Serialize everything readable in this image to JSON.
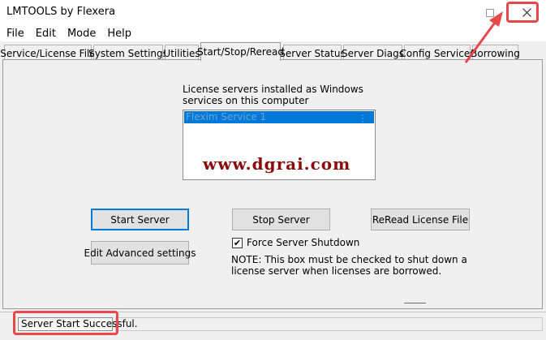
{
  "window": {
    "title": "LMTOOLS by Flexera",
    "buttons": {
      "minimize": "minimize-icon",
      "maximize": "maximize-icon",
      "close": "close-icon"
    }
  },
  "menu": [
    "File",
    "Edit",
    "Mode",
    "Help"
  ],
  "tabs": [
    {
      "label": "Service/License File"
    },
    {
      "label": "System Settings"
    },
    {
      "label": "Utilities"
    },
    {
      "label": "Start/Stop/Reread",
      "active": true
    },
    {
      "label": "Server Status"
    },
    {
      "label": "Server Diags"
    },
    {
      "label": "Config Services"
    },
    {
      "label": "Borrowing"
    }
  ],
  "main": {
    "services_label": "License servers installed as Windows services on this computer",
    "services_list": [
      "Flexim Service 1"
    ],
    "watermark": "www.dgrai.com",
    "buttons": {
      "start": "Start Server",
      "stop": "Stop Server",
      "reread": "ReRead License File",
      "advanced": "Edit Advanced settings"
    },
    "force_shutdown": {
      "label": "Force Server Shutdown",
      "checked": true,
      "mark": "✔"
    },
    "note": "NOTE:  This box must be checked to shut down a license server when licenses are borrowed."
  },
  "status": {
    "text": "Server Start Successful."
  },
  "colors": {
    "highlight": "#e8484c",
    "selection": "#0078d7",
    "watermark": "#8b0a0a"
  }
}
